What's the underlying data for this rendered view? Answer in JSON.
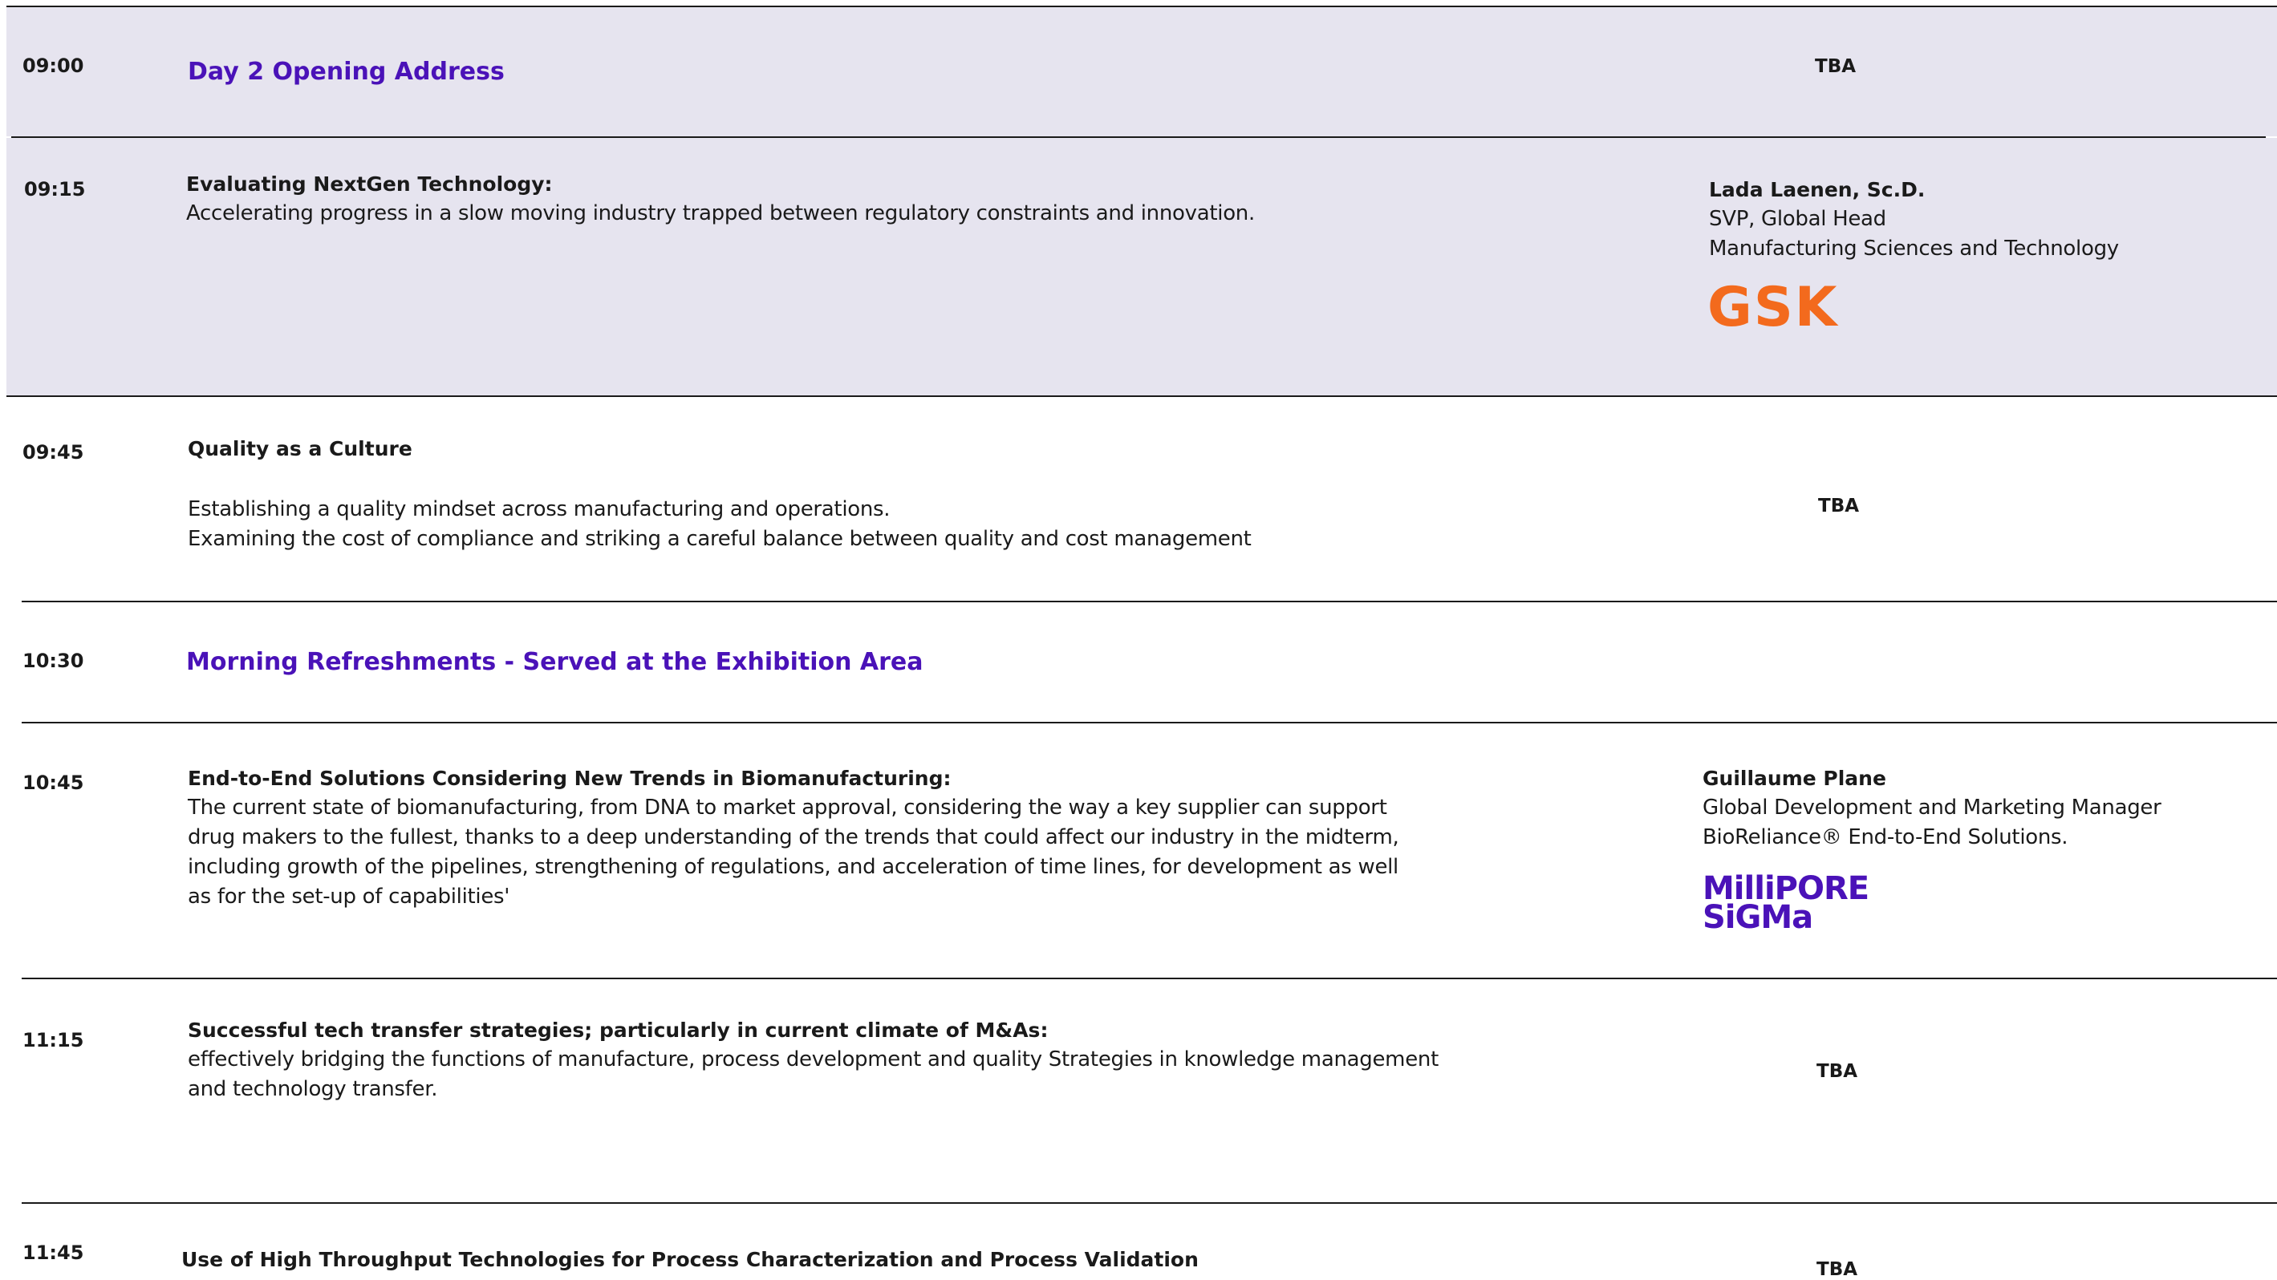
{
  "sessions": [
    {
      "time": "09:00",
      "title": "Day 2 Opening Address",
      "speaker": "TBA"
    },
    {
      "time": "09:15",
      "title": "Evaluating NextGen Technology:",
      "description": [
        "Accelerating progress in a slow moving industry trapped between regulatory constraints and innovation."
      ],
      "speaker_name": "Lada Laenen, Sc.D.",
      "speaker_role": "SVP, Global Head",
      "speaker_org": "Manufacturing Sciences and Technology",
      "logo_text": "GSK"
    },
    {
      "time": "09:45",
      "title": "Quality as a Culture",
      "description": [
        "Establishing a quality mindset across manufacturing and operations.",
        "Examining the cost of compliance and striking a careful balance between quality and cost management"
      ],
      "speaker": "TBA"
    },
    {
      "time": "10:30",
      "title": "Morning Refreshments  -  Served at the Exhibition Area"
    },
    {
      "time": "10:45",
      "title": "End-to-End Solutions Considering New Trends in Biomanufacturing:",
      "description": [
        "The current state of biomanufacturing, from DNA to market approval, considering the way a key supplier can support",
        "drug makers to the fullest, thanks to a deep understanding of the trends that could affect our industry in the midterm,",
        "including growth of the pipelines, strengthening of regulations, and acceleration of time lines, for development as well",
        "as for the set-up of capabilities'"
      ],
      "speaker_name": "Guillaume Plane",
      "speaker_role": "Global Development and Marketing Manager",
      "speaker_org": "BioReliance® End-to-End Solutions.",
      "logo_text_line1": "MilliPORE",
      "logo_text_line2": "SiGMa"
    },
    {
      "time": "11:15",
      "title": "Successful tech transfer strategies; particularly in current climate of M&As:",
      "description": [
        "effectively bridging the functions of manufacture, process development and quality Strategies in knowledge management",
        "and technology transfer."
      ],
      "speaker": "TBA"
    },
    {
      "time": "11:45",
      "title": "Use of High Throughput Technologies for Process Characterization and Process Validation",
      "speaker": "TBA"
    }
  ],
  "colors": {
    "accent": "#4a12b8",
    "highlight_bg": "#e6e4ef",
    "gsk_orange": "#f36a1d",
    "text": "#1a1a1a"
  }
}
